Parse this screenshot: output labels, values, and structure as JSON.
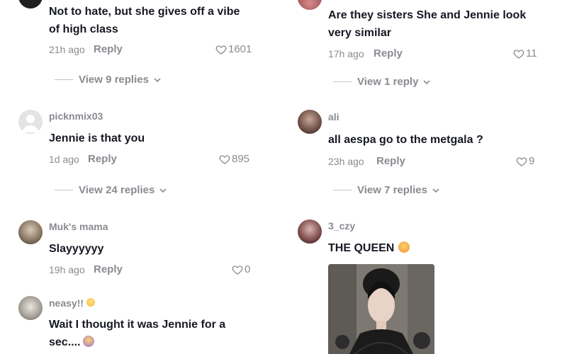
{
  "left": {
    "c1": {
      "text_line1": "Not to hate, but she gives off a vibe",
      "text_line2": "of high class",
      "time": "21h ago",
      "reply": "Reply",
      "likes": "1601",
      "view_replies": "View 9 replies"
    },
    "c2": {
      "username": "picknmix03",
      "text": "Jennie is that you",
      "time": "1d ago",
      "reply": "Reply",
      "likes": "895",
      "view_replies": "View 24 replies"
    },
    "c3": {
      "username": "Muk's mama",
      "text": "Slayyyyyy",
      "time": "19h ago",
      "reply": "Reply",
      "likes": "0"
    },
    "c4": {
      "username": "neasy!!",
      "text_line1": "Wait I thought it was Jennie for a",
      "text_line2": "sec...."
    }
  },
  "right": {
    "c1": {
      "text_line1": "Are they sisters She and Jennie look",
      "text_line2": "very similar",
      "time": "17h ago",
      "reply": "Reply",
      "likes": "11",
      "view_replies": "View 1 reply"
    },
    "c2": {
      "username": "ali",
      "text": "all aespa go to the metgala ?",
      "time": "23h ago",
      "reply": "Reply",
      "likes": "9",
      "view_replies": "View 7 replies"
    },
    "c3": {
      "username": "3_czy",
      "text": "THE QUEEN"
    }
  }
}
